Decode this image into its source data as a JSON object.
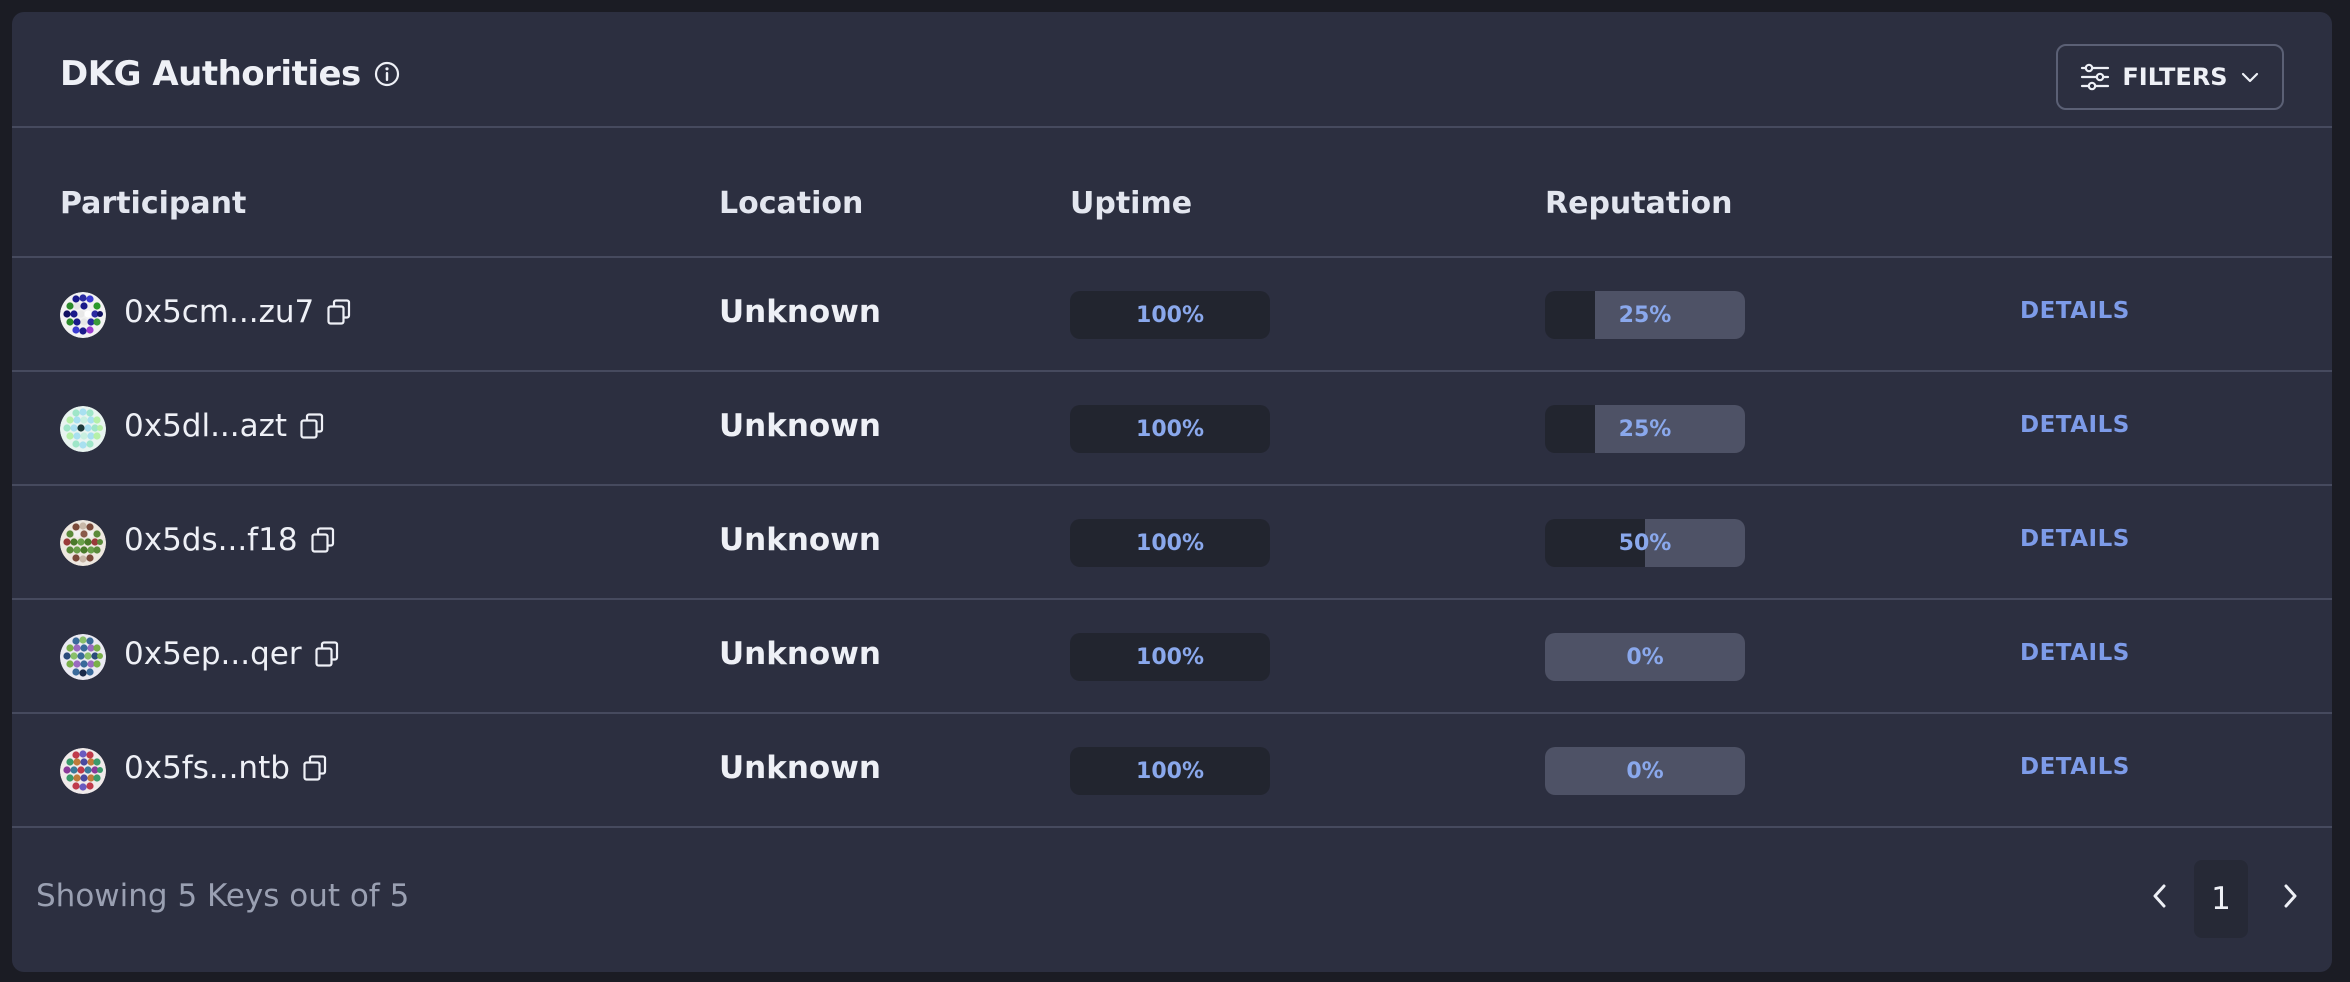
{
  "header": {
    "title": "DKG Authorities",
    "filters_label": "FILTERS"
  },
  "columns": {
    "participant": "Participant",
    "location": "Location",
    "uptime": "Uptime",
    "reputation": "Reputation"
  },
  "rows": [
    {
      "address": "0x5cm...zu7",
      "location": "Unknown",
      "uptime": "100%",
      "uptime_value": 1.0,
      "reputation": "25%",
      "reputation_value": 0.25,
      "details": "DETAILS"
    },
    {
      "address": "0x5dl...azt",
      "location": "Unknown",
      "uptime": "100%",
      "uptime_value": 1.0,
      "reputation": "25%",
      "reputation_value": 0.25,
      "details": "DETAILS"
    },
    {
      "address": "0x5ds...f18",
      "location": "Unknown",
      "uptime": "100%",
      "uptime_value": 1.0,
      "reputation": "50%",
      "reputation_value": 0.5,
      "details": "DETAILS"
    },
    {
      "address": "0x5ep...qer",
      "location": "Unknown",
      "uptime": "100%",
      "uptime_value": 1.0,
      "reputation": "0%",
      "reputation_value": 0.0,
      "details": "DETAILS"
    },
    {
      "address": "0x5fs...ntb",
      "location": "Unknown",
      "uptime": "100%",
      "uptime_value": 1.0,
      "reputation": "0%",
      "reputation_value": 0.0,
      "details": "DETAILS"
    }
  ],
  "footer": {
    "summary": "Showing 5 Keys out of 5",
    "current_page": "1"
  },
  "icons": {
    "title_info": "info-icon",
    "filters": "sliders-icon",
    "filters_caret": "chevron-down-icon",
    "copy": "copy-icon",
    "prev": "chevron-left-icon",
    "next": "chevron-right-icon"
  },
  "colors": {
    "panel_bg": "#2c2f40",
    "accent": "#7d9be8",
    "bar_track": "#22252f",
    "bar_fill": "#4e5266"
  }
}
